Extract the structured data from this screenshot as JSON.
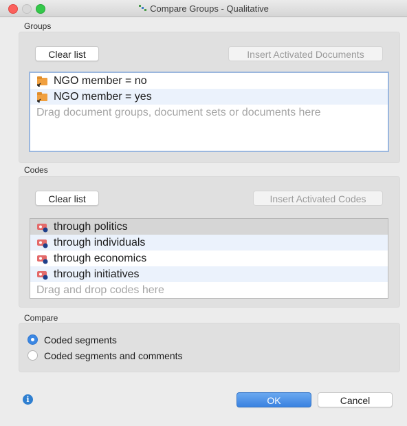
{
  "window": {
    "title": "Compare Groups - Qualitative",
    "title_icon": "compare-groups-icon"
  },
  "groups": {
    "label": "Groups",
    "clear_label": "Clear list",
    "insert_label": "Insert Activated Documents",
    "items": [
      {
        "label": "NGO member = no",
        "icon": "document-group-icon"
      },
      {
        "label": "NGO member = yes",
        "icon": "document-group-icon"
      }
    ],
    "placeholder": "Drag document groups, document sets or documents here"
  },
  "codes": {
    "label": "Codes",
    "clear_label": "Clear list",
    "insert_label": "Insert Activated Codes",
    "items": [
      {
        "label": "through politics",
        "icon": "code-icon"
      },
      {
        "label": "through individuals",
        "icon": "code-icon"
      },
      {
        "label": "through economics",
        "icon": "code-icon"
      },
      {
        "label": "through initiatives",
        "icon": "code-icon"
      }
    ],
    "placeholder": "Drag and drop codes here"
  },
  "compare": {
    "label": "Compare",
    "options": [
      {
        "label": "Coded segments",
        "selected": true
      },
      {
        "label": "Coded segments and comments",
        "selected": false
      }
    ]
  },
  "footer": {
    "info_icon": "info-icon",
    "ok_label": "OK",
    "cancel_label": "Cancel"
  },
  "colors": {
    "accent": "#3b87e3",
    "alt_row": "#ebf2fc",
    "selected_row": "#d6d6d6",
    "panel": "#e0e0e0"
  }
}
